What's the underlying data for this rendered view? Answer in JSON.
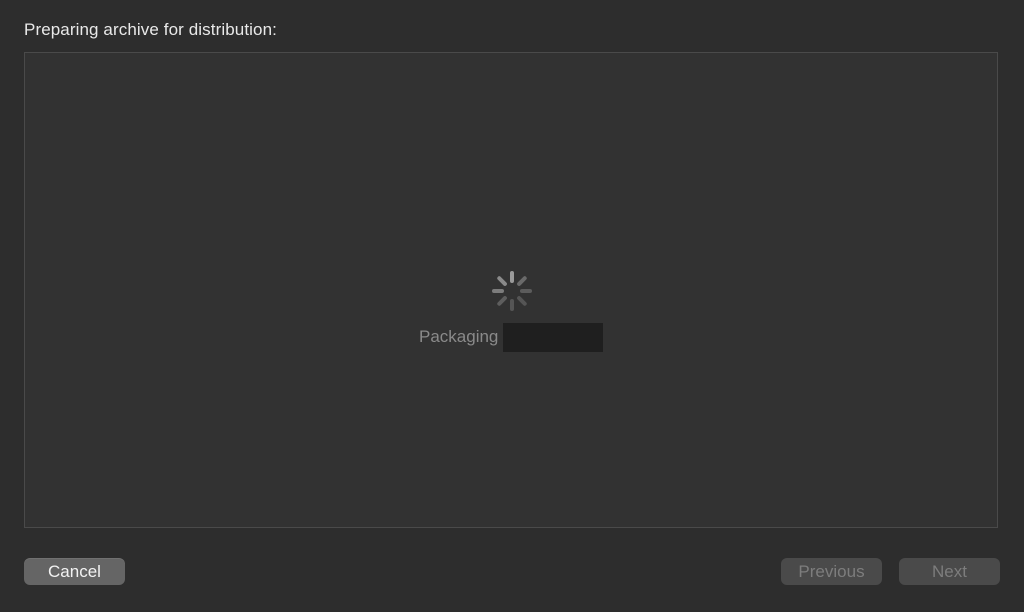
{
  "dialog": {
    "title": "Preparing archive for distribution:",
    "status_text": "Packaging"
  },
  "buttons": {
    "cancel_label": "Cancel",
    "previous_label": "Previous",
    "next_label": "Next"
  },
  "icons": {
    "spinner": "spinner-icon"
  },
  "colors": {
    "background": "#2d2d2d",
    "panel": "#323232",
    "border": "#4a4a4a",
    "text_primary": "#e9e9e9",
    "text_muted": "#8a8a8a",
    "button_enabled": "#656565",
    "button_disabled": "#4a4a4a",
    "redaction": "#1f1f1f"
  }
}
